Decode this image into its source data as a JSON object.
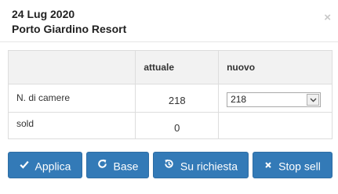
{
  "header": {
    "date": "24 Lug 2020",
    "hotel": "Porto Giardino Resort",
    "close_glyph": "×"
  },
  "table": {
    "columns": [
      "",
      "attuale",
      "nuovo"
    ],
    "rows": [
      {
        "label": "N. di camere",
        "current": "218",
        "new_value": "218"
      },
      {
        "label": "sold",
        "current": "0",
        "new_value": ""
      }
    ]
  },
  "buttons": {
    "apply": {
      "label": "Applica",
      "icon": "check-icon"
    },
    "base": {
      "label": "Base",
      "icon": "refresh-icon"
    },
    "on_request": {
      "label": "Su richiesta",
      "icon": "history-icon"
    },
    "stop_sell": {
      "label": "Stop sell",
      "icon": "times-icon"
    }
  },
  "colors": {
    "primary": "#337ab7",
    "header_bg": "#f2f2f2",
    "border": "#dddddd"
  }
}
